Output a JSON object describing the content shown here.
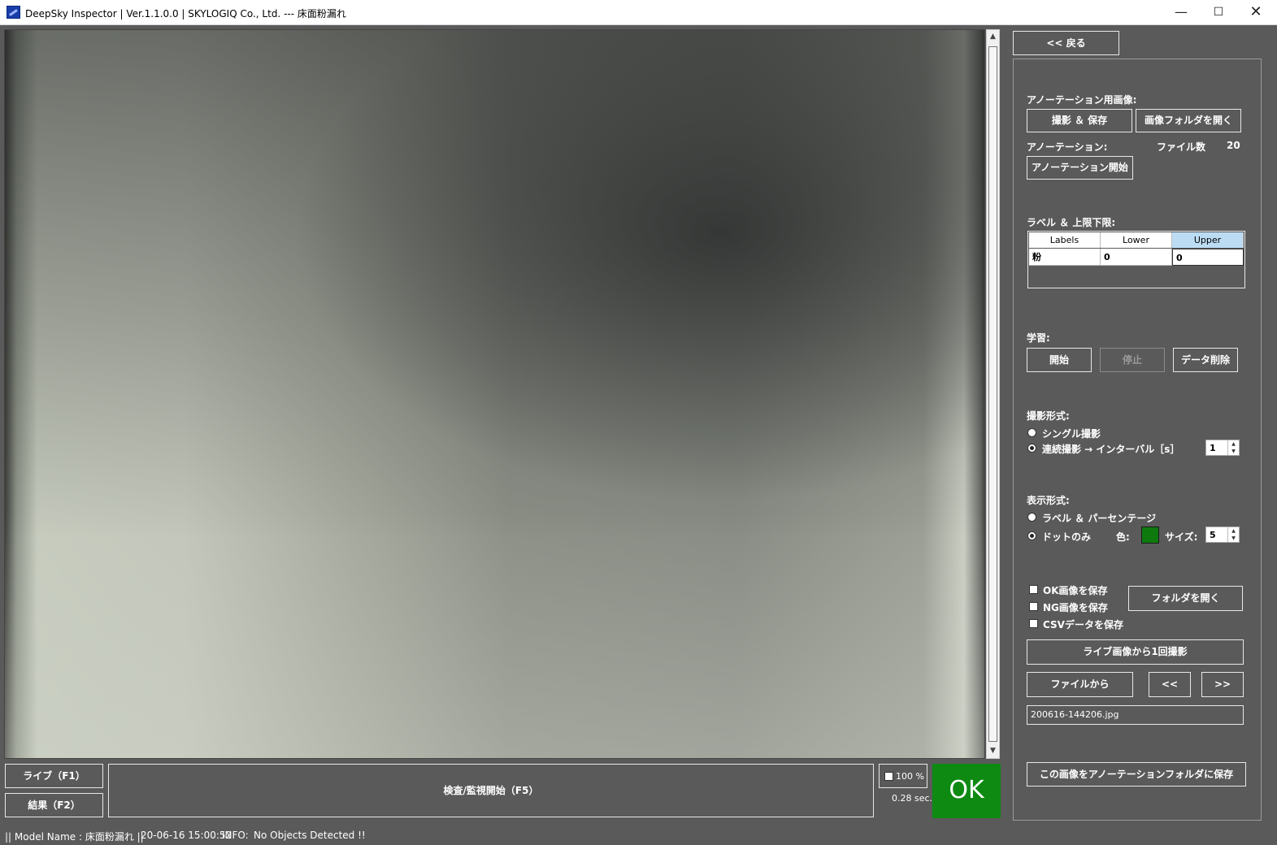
{
  "window": {
    "title": "DeepSky Inspector | Ver.1.1.0.0 | SKYLOGIQ Co., Ltd. --- 床面粉漏れ",
    "minimize": "—",
    "maximize": "☐",
    "close": "✕"
  },
  "left": {
    "live_button": "ライブ（F1）",
    "result_button": "結果（F2）",
    "inspect_button": "検査/監視開始（F5）",
    "zoom_label": "100 %",
    "elapsed": "0.28 sec.",
    "judgement": "OK"
  },
  "status": {
    "model": "|| Model Name : 床面粉漏れ ||",
    "timestamp": "20-06-16 15:00:52",
    "info_label": "INFO:",
    "info_text": "No Objects Detected !!"
  },
  "right": {
    "back_button": "<< 戻る",
    "annotation_image_label": "アノーテーション用画像:",
    "capture_save_button": "撮影 ＆ 保存",
    "open_image_folder_button": "画像フォルダを開く",
    "annotation_label": "アノーテーション:",
    "file_count_label": "ファイル数",
    "file_count_value": "20",
    "start_annotation_button": "アノーテーション開始",
    "label_limit_label": "ラベル ＆ 上限下限:",
    "grid": {
      "headers": [
        "Labels",
        "Lower",
        "Upper"
      ],
      "rows": [
        [
          "粉",
          "0",
          "0"
        ]
      ]
    },
    "learning_label": "学習:",
    "learn_start": "開始",
    "learn_stop": "停止",
    "learn_delete": "データ削除",
    "capture_mode_label": "撮影形式:",
    "single_capture": "シングル撮影",
    "continuous_capture": "連続撮影 → インターバル［s］",
    "interval_value": "1",
    "display_mode_label": "表示形式:",
    "label_percentage": "ラベル ＆ パーセンテージ",
    "dot_only": "ドットのみ",
    "color_label": "色:",
    "color_value": "#0e7a0e",
    "size_label": "サイズ:",
    "size_value": "5",
    "save_ok": "OK画像を保存",
    "save_ng": "NG画像を保存",
    "save_csv": "CSVデータを保存",
    "open_folder_button": "フォルダを開く",
    "capture_from_live": "ライブ画像から1回撮影",
    "from_file": "ファイルから",
    "prev": "<<",
    "next": ">>",
    "file_name": "200616-144206.jpg",
    "save_to_annotation": "この画像をアノーテーションフォルダに保存"
  }
}
